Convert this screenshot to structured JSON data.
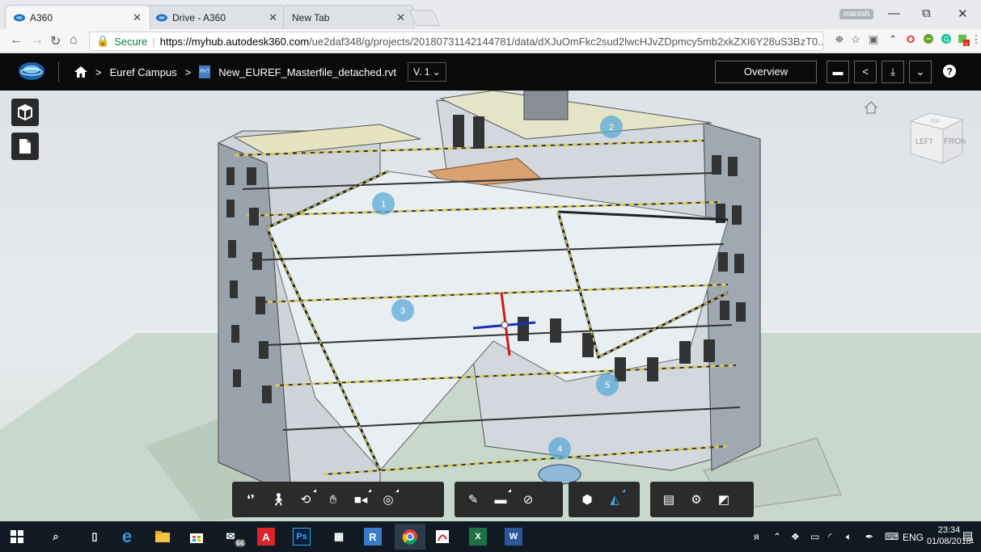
{
  "browser": {
    "tabs": [
      {
        "label": "A360",
        "active": true
      },
      {
        "label": "Drive - A360",
        "active": false
      },
      {
        "label": "New Tab",
        "active": false
      }
    ],
    "user_name": "manish",
    "window_controls": {
      "minimize": "—",
      "restore": "⧉",
      "close": "✕"
    },
    "secure_label": "Secure",
    "url_host": "https://myhub.autodesk360.com",
    "url_path": "/ue2daf348/g/projects/20180731142144781/data/dXJuOmFkc2sud2lwcHJvZDpmcy5mb2xkZXI6Y28uS3BzT0...",
    "extensions": [
      "translate-icon",
      "star-icon",
      "cast-icon",
      "ext-arrow-icon",
      "opera-icon",
      "ext-green-icon",
      "grammarly-icon",
      "ext-notify-icon",
      "menu-icon"
    ],
    "extension_badge": "1"
  },
  "header": {
    "breadcrumb_project": "Euref Campus",
    "breadcrumb_separator": ">",
    "file_badge": "RVT",
    "file_name": "New_EUREF_Masterfile_detached.rvt",
    "version": "V. 1",
    "overview_label": "Overview"
  },
  "viewer": {
    "viewcube_faces": {
      "left": "LEFT",
      "front": "FRONT",
      "top": "TOP"
    },
    "markers": [
      "1",
      "2",
      "3",
      "4",
      "5"
    ],
    "accent_color": "#39a6e0",
    "toolbar_groups": [
      [
        "first-person-icon",
        "walk-icon",
        "orbit-icon",
        "pan-icon",
        "camera-icon",
        "fit-view-icon"
      ],
      [
        "markup-icon",
        "comment-icon",
        "hide-icon"
      ],
      [
        "explode-icon",
        "section-icon"
      ],
      [
        "model-browser-icon",
        "settings-icon",
        "fullscreen-icon"
      ]
    ]
  },
  "taskbar": {
    "apps": [
      "start",
      "search",
      "task-view",
      "edge",
      "explorer",
      "store",
      "mail",
      "acrobat",
      "photoshop",
      "calculator",
      "revit",
      "chrome",
      "pdf",
      "excel",
      "word"
    ],
    "mail_count": "66",
    "photoshop_label": "Ps",
    "revit_label": "R",
    "excel_label": "X",
    "word_label": "W",
    "acrobat_label": "A",
    "language": "ENG",
    "time": "23:34",
    "date": "01/08/2018",
    "notification_count": "1"
  }
}
